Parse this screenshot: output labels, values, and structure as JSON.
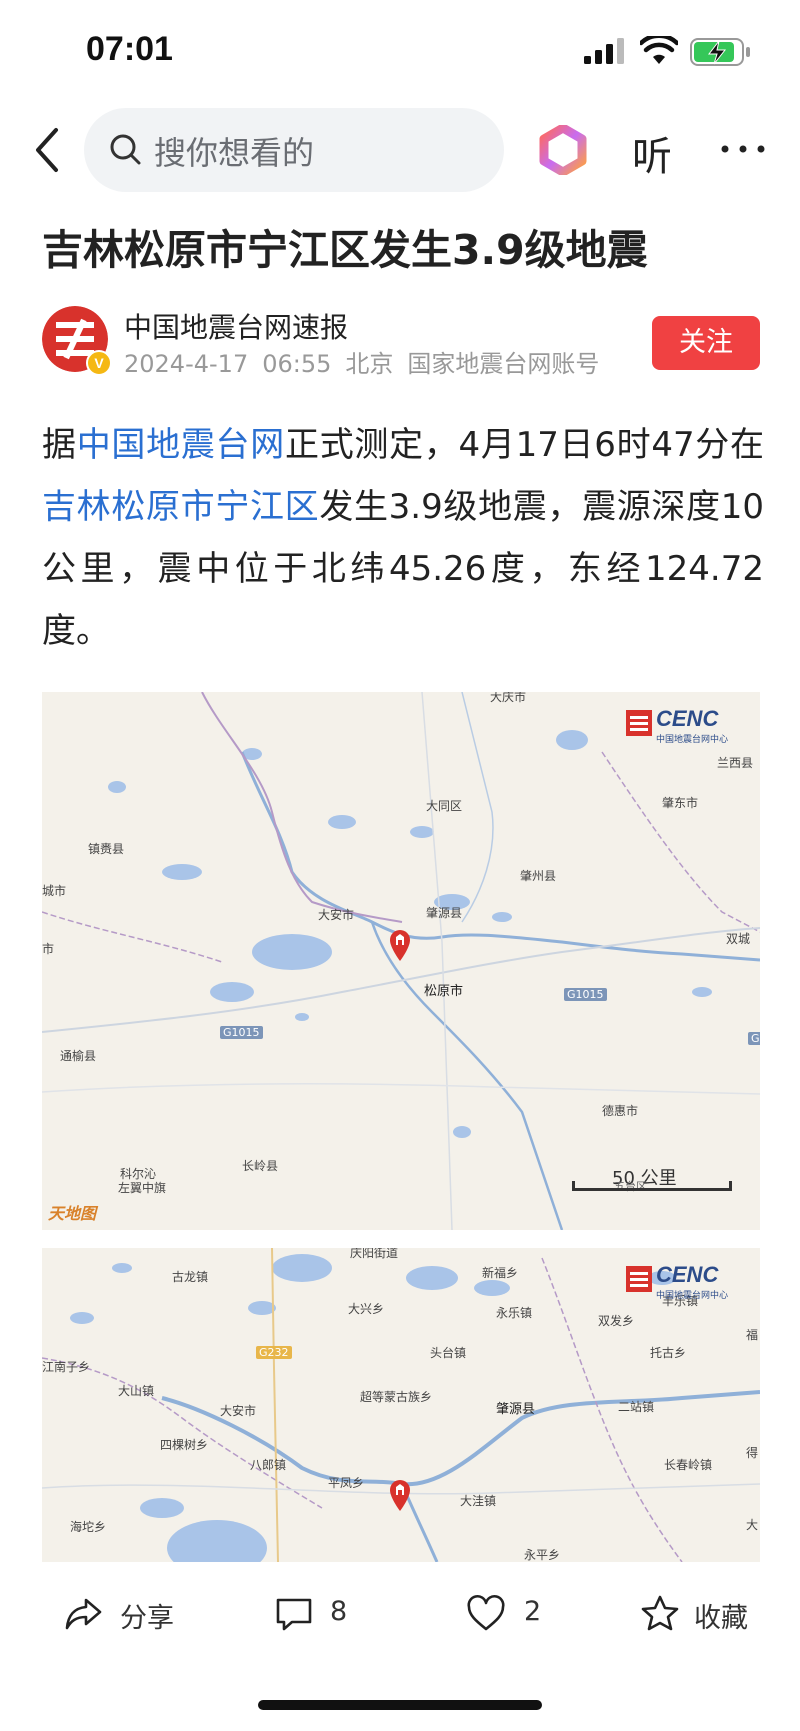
{
  "status_bar": {
    "time": "07:01"
  },
  "nav": {
    "search_placeholder": "搜你想看的",
    "listen_label": "听"
  },
  "article": {
    "title": "吉林松原市宁江区发生3.9级地震",
    "author": {
      "name": "中国地震台网速报",
      "date": "2024-4-17",
      "time": "06:55",
      "location": "北京",
      "account_type": "国家地震台网账号",
      "verified_badge": "V"
    },
    "follow_label": "关注",
    "body": {
      "p1": "据",
      "link1": "中国地震台网",
      "p2": "正式测定，4月17日6时47分在",
      "link2": "吉林松原市宁江区",
      "p3": "发生3.9级地震，震源深度10公里，震中位于北纬45.26度，东经124.72度。"
    }
  },
  "map1": {
    "watermark_title": "CENC",
    "watermark_sub": "中国地震台网中心",
    "scale_label": "50 公里",
    "provider_logo": "天地图",
    "labels": {
      "daqing": "大庆市",
      "lanxi": "兰西县",
      "datong": "大同区",
      "zhaodong": "肇东市",
      "zhenlai": "镇赉县",
      "zhaozhou": "肇州县",
      "chengshi": "城市",
      "daan": "大安市",
      "zhaoyuan": "肇源县",
      "shuangcheng": "双城",
      "shi": "市",
      "songyuan": "松原市",
      "tongyu": "通榆县",
      "dehui": "德惠市",
      "changling": "长岭县",
      "keerqin": "科尔沁",
      "zuoyi": "左翼中旗",
      "wutai": "五台区"
    },
    "road_labels": {
      "g1015_a": "G1015",
      "g1015_b": "G1015",
      "g_edge": "G"
    }
  },
  "map2": {
    "watermark_title": "CENC",
    "watermark_sub": "中国地震台网中心",
    "labels": {
      "qingshan": "庆阳街道",
      "gulong": "古龙镇",
      "xinfu": "新福乡",
      "fengle": "丰乐镇",
      "daxing": "大兴乡",
      "yongle": "永乐镇",
      "shuangfa": "双发乡",
      "fu": "福",
      "toutai": "头台镇",
      "tuogu": "托古乡",
      "jiangnan": "江南子乡",
      "dashan": "大山镇",
      "chaodeng": "超等蒙古族乡",
      "zhaoyuan": "肇源县",
      "erzhan": "二站镇",
      "daan": "大安市",
      "sikeshu": "四棵树乡",
      "balang": "八郎镇",
      "changchunling": "长春岭镇",
      "de": "得",
      "pingfeng": "平凤乡",
      "dawa": "大洼镇",
      "hailong": "海坨乡",
      "da": "大",
      "yongping": "永平乡"
    },
    "road_label": "G232"
  },
  "actions": {
    "share_label": "分享",
    "comment_count": "8",
    "like_count": "2",
    "favorite_label": "收藏"
  }
}
